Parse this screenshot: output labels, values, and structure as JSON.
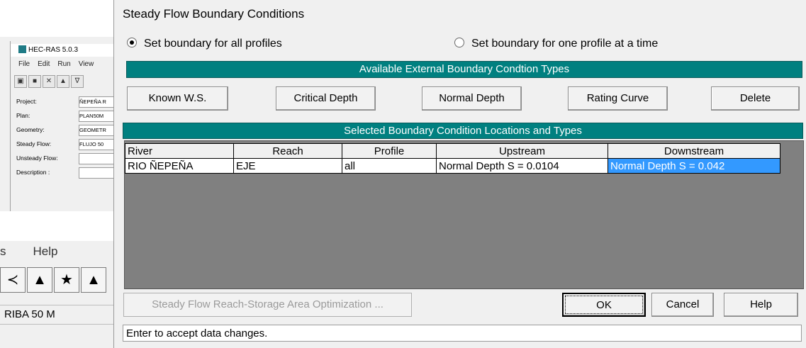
{
  "background_window": {
    "title": "HEC-RAS 5.0.3",
    "menu": [
      "File",
      "Edit",
      "Run",
      "View"
    ],
    "fields": [
      {
        "label": "Project:",
        "value": "ÑEPEÑA R"
      },
      {
        "label": "Plan:",
        "value": "PLAN50M"
      },
      {
        "label": "Geometry:",
        "value": "GEOMETR"
      },
      {
        "label": "Steady Flow:",
        "value": "FLUJO 50"
      },
      {
        "label": "Unsteady Flow:",
        "value": ""
      },
      {
        "label": "Description :",
        "value": ""
      }
    ],
    "help_menu_partial": "s",
    "help_menu": "Help",
    "status_text": "RIBA 50 M"
  },
  "dialog": {
    "title": "Steady Flow Boundary Conditions",
    "radio_all": "Set boundary for all profiles",
    "radio_one": "Set boundary for one profile at a time",
    "radio_selected": "all",
    "types_header": "Available External Boundary Condtion Types",
    "buttons": {
      "known_ws": "Known W.S.",
      "critical_depth": "Critical Depth",
      "normal_depth": "Normal Depth",
      "rating_curve": "Rating Curve",
      "delete": "Delete"
    },
    "locations_header": "Selected Boundary Condition Locations and Types",
    "table": {
      "headers": [
        "River",
        "Reach",
        "Profile",
        "Upstream",
        "Downstream"
      ],
      "rows": [
        {
          "river": "RIO ÑEPEÑA",
          "reach": "EJE",
          "profile": "all",
          "upstream": "Normal Depth S = 0.0104",
          "downstream": "Normal Depth S = 0.042"
        }
      ]
    },
    "optimization_button": "Steady Flow Reach-Storage Area Optimization ...",
    "ok": "OK",
    "cancel": "Cancel",
    "help": "Help",
    "status": "Enter to accept data changes."
  },
  "colors": {
    "teal": "#008080",
    "selection": "#3399ff",
    "table_background": "#808080"
  }
}
